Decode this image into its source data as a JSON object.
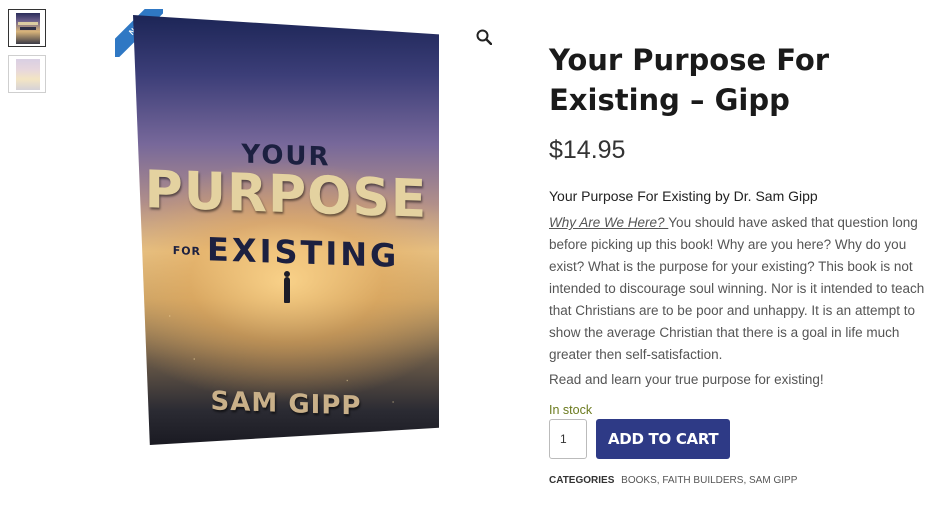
{
  "gallery": {
    "badge": "NEW",
    "thumbnails": [
      "thumbnail-cover",
      "thumbnail-cover-alt"
    ],
    "zoom_icon": "magnifier-icon",
    "cover": {
      "line1": "YOUR",
      "line2": "PURPOSE",
      "line3_prefix": "FOR",
      "line3": "EXISTING",
      "author": "SAM GIPP"
    }
  },
  "product": {
    "title": "Your Purpose For Existing – Gipp",
    "price": "$14.95",
    "description_heading": "Your Purpose For Existing by Dr. Sam Gipp",
    "description_lead": "Why Are We Here? ",
    "description_body": "You should have asked that question long before picking up this book! Why are you here? Why do you exist? What is the purpose for your existing? This book is not intended to discourage soul winning. Nor is it intended to teach that Christians are to be poor and unhappy. It is an attempt to show the average Christian that there is a goal in life much greater then self-satisfaction.",
    "description_tail": "Read and learn your true purpose for existing!",
    "stock": "In stock",
    "quantity": "1",
    "add_to_cart": "ADD TO CART",
    "categories_label": "CATEGORIES",
    "categories": [
      "BOOKS",
      "FAITH BUILDERS",
      "SAM GIPP"
    ]
  },
  "colors": {
    "button": "#2e3a86",
    "badge": "#2f78c4",
    "stock": "#6b7a1e"
  }
}
